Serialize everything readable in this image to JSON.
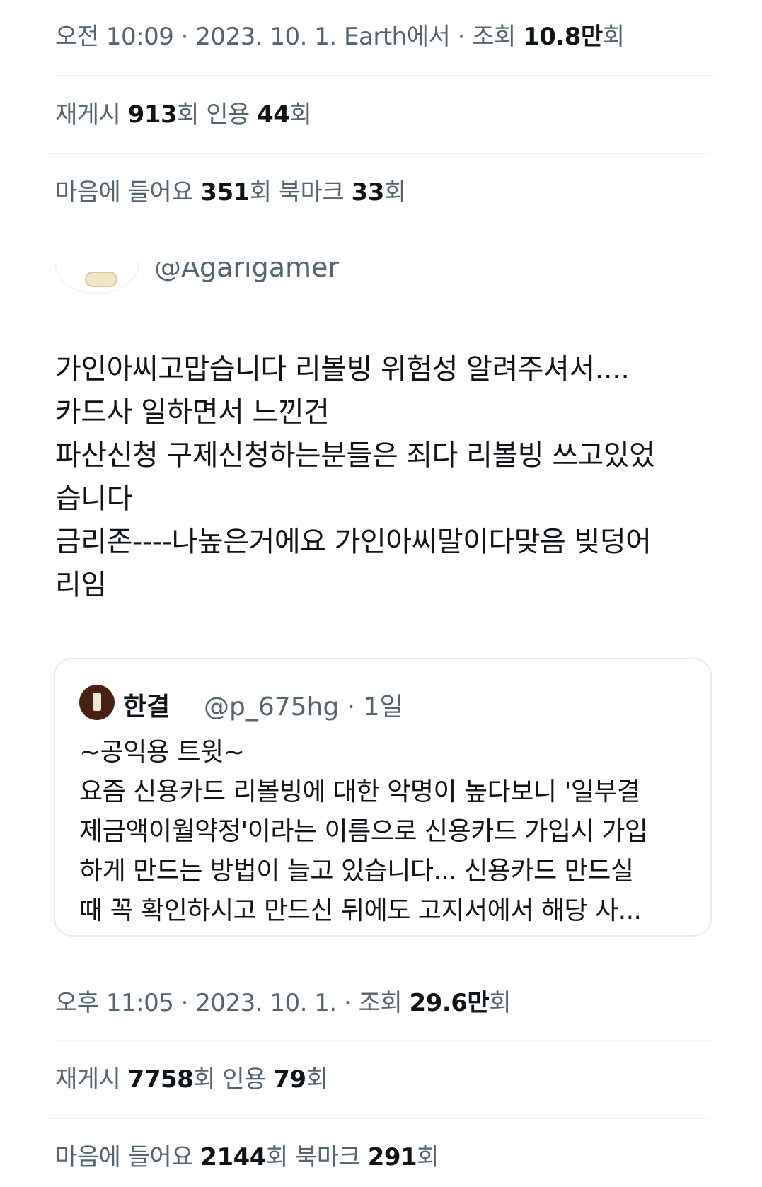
{
  "prev_tweet": {
    "time_line": {
      "prefix": "오전 10:09 · 2023. 10. 1. Earth에서 · 조회 ",
      "views": "10.8만",
      "suffix": "회"
    },
    "stats1": {
      "retweet_label": "재게시 ",
      "retweet_count": "913",
      "retweet_unit": "회  인용 ",
      "quote_count": "44",
      "quote_unit": "회"
    },
    "stats2": {
      "like_label": "마음에 들어요 ",
      "like_count": "351",
      "like_unit": "회  북마크 ",
      "bookmark_count": "33",
      "bookmark_unit": "회"
    }
  },
  "tweet": {
    "author_handle": "@Agarigamer",
    "body": "가인아씨고맙습니다 리볼빙 위험성 알려주셔서....\n카드사 일하면서 느낀건\n파산신청 구제신청하는분들은 죄다 리볼빙 쓰고있었\n습니다\n금리존----나높은거에요 가인아씨말이다맞음 빚덩어\n리임",
    "quote": {
      "name": "한결",
      "handle_time": "@p_675hg · 1일",
      "text": "~공익용 트윗~\n요즘 신용카드 리볼빙에 대한 악명이 높다보니 '일부결\n제금액이월약정'이라는 이름으로 신용카드 가입시 가입\n하게 만드는 방법이 늘고 있습니다... 신용카드 만드실\n때 꼭 확인하시고 만드신 뒤에도 고지서에서 해당 사..."
    },
    "time_line": {
      "prefix": "오후 11:05 · 2023. 10. 1. · 조회 ",
      "views": "29.6만",
      "suffix": "회"
    },
    "stats1": {
      "retweet_label": "재게시 ",
      "retweet_count": "7758",
      "retweet_unit": "회  인용 ",
      "quote_count": "79",
      "quote_unit": "회"
    },
    "stats2": {
      "like_label": "마음에 들어요 ",
      "like_count": "2144",
      "like_unit": "회  북마크 ",
      "bookmark_count": "291",
      "bookmark_unit": "회"
    }
  }
}
